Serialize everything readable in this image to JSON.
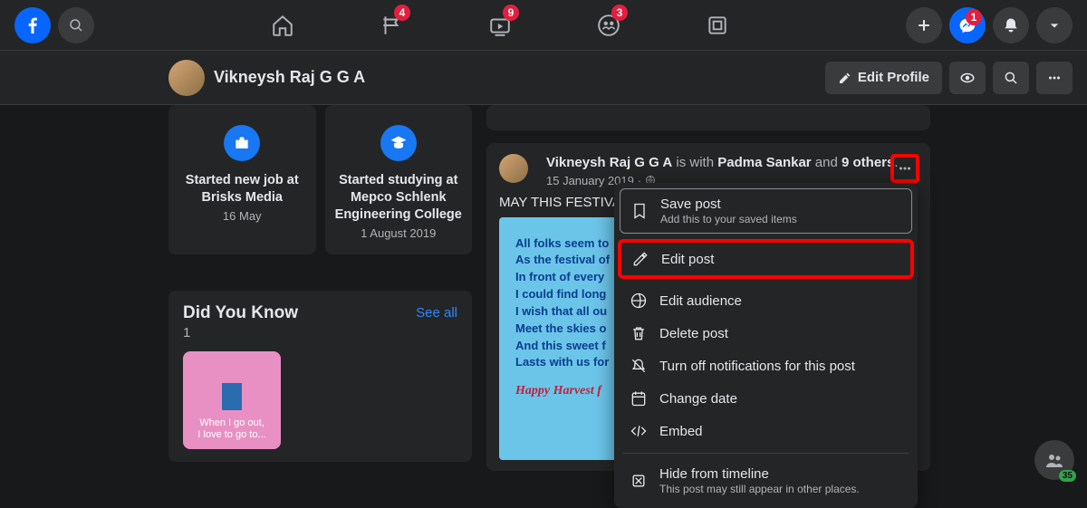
{
  "nav": {
    "badges": {
      "pages": "4",
      "watch": "9",
      "groups": "3",
      "messenger": "1"
    }
  },
  "profile": {
    "name": "Vikneysh Raj G G A",
    "edit": "Edit Profile"
  },
  "life": [
    {
      "title": "Started new job at Brisks Media",
      "sub": "16 May"
    },
    {
      "title": "Started studying at Mepco Schlenk Engineering College",
      "sub": "1 August 2019"
    }
  ],
  "dyk": {
    "title": "Did You Know",
    "seeall": "See all",
    "count": "1",
    "card_l1": "When I go out,",
    "card_l2": "I love to go to..."
  },
  "post": {
    "author": "Vikneysh Raj G G A",
    "with": " is with ",
    "tag1": "Padma Sankar",
    "and": " and ",
    "tag2": "9 others",
    "dot": ".",
    "date": "15 January 2019",
    "caption": "MAY THIS FESTIVA",
    "poem": [
      "All folks seem to",
      "As the festival of",
      "In front of every",
      "I could find long",
      "I wish that all ou",
      "Meet the skies o",
      "And this sweet  f",
      "Lasts with us for"
    ],
    "harvest": "Happy Harvest f"
  },
  "menu": {
    "save": {
      "t": "Save post",
      "s": "Add this to your saved items"
    },
    "edit": "Edit post",
    "aud": "Edit audience",
    "del": "Delete post",
    "notif": "Turn off notifications for this post",
    "date": "Change date",
    "embed": "Embed",
    "hide": {
      "t": "Hide from timeline",
      "s": "This post may still appear in other places."
    }
  },
  "fab": {
    "count": "35"
  }
}
